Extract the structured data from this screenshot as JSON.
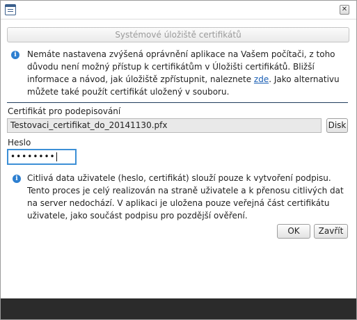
{
  "titlebar": {
    "close_symbol": "✕"
  },
  "store_button_label": "Systémové úložiště certifikátů",
  "info_1": {
    "text_before": "Nemáte nastavena zvýšená oprávnění aplikace na Vašem počítači, z toho důvodu není možný přístup k certifikátům v Úložišti certifikátů. Bližší informace a návod, jak úložiště zpřístupnit, naleznete ",
    "link": "zde",
    "text_after": ". Jako alternativu můžete také použít certifikát uložený v souboru."
  },
  "certificate": {
    "label": "Certifikát pro podepisování",
    "value": "Testovaci_certifikat_do_20141130.pfx",
    "disk_button": "Disk"
  },
  "password": {
    "label": "Heslo",
    "masked_value": "••••••••"
  },
  "info_2": {
    "text": "Citlivá data uživatele (heslo, certifikát) slouží pouze k vytvoření podpisu. Tento proces je celý realizován na straně uživatele a k přenosu citlivých dat na server nedochází. V aplikaci je uložena pouze veřejná část certifikátu uživatele, jako součást podpisu pro pozdější ověření."
  },
  "buttons": {
    "ok": "OK",
    "close": "Zavřít"
  },
  "colors": {
    "accent": "#1f3b5c",
    "focus": "#3c8fd6",
    "info_icon": "#2d7fd0",
    "footer": "#2b2b2b"
  }
}
